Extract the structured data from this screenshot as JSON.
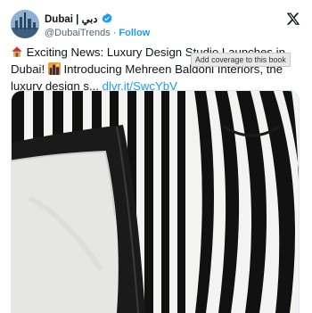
{
  "account": {
    "display_name": "Dubai | دبي",
    "handle": "@DubaiTrends",
    "separator": "·",
    "follow_label": "Follow",
    "verified": true,
    "brand_color": "#1d9bf0"
  },
  "tweet": {
    "text_part1": "Exciting News: Luxury Design Studio Launches in Dubai!",
    "text_part2": "Introducing Mehreen Baldoni Interiors, the luxury design s...",
    "link_text": "dlvr.it/SwcYbV",
    "leading_emoji": "house-icon",
    "inline_emoji": "cityscape-icon"
  },
  "tooltip": {
    "text": "Add coverage to this book"
  },
  "media": {
    "description_icon": "striped-armchair-with-cushion",
    "stripe_colors": [
      "#111111",
      "#f4f4f2"
    ]
  }
}
